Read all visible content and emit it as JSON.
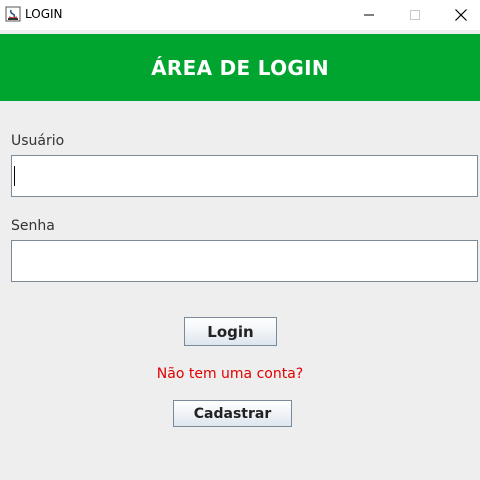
{
  "window": {
    "title": "LOGIN",
    "icon": "java-app-icon",
    "controls": {
      "minimize_icon": "minimize-icon",
      "maximize_icon": "maximize-icon",
      "close_icon": "close-icon"
    }
  },
  "header": {
    "title": "ÁREA DE LOGIN",
    "background_color": "#00a530",
    "text_color": "#ffffff"
  },
  "form": {
    "username_label": "Usuário",
    "username_value": "",
    "password_label": "Senha",
    "password_value": ""
  },
  "actions": {
    "login_label": "Login",
    "no_account_text": "Não tem uma conta?",
    "no_account_color": "#e00000",
    "signup_label": "Cadastrar"
  }
}
